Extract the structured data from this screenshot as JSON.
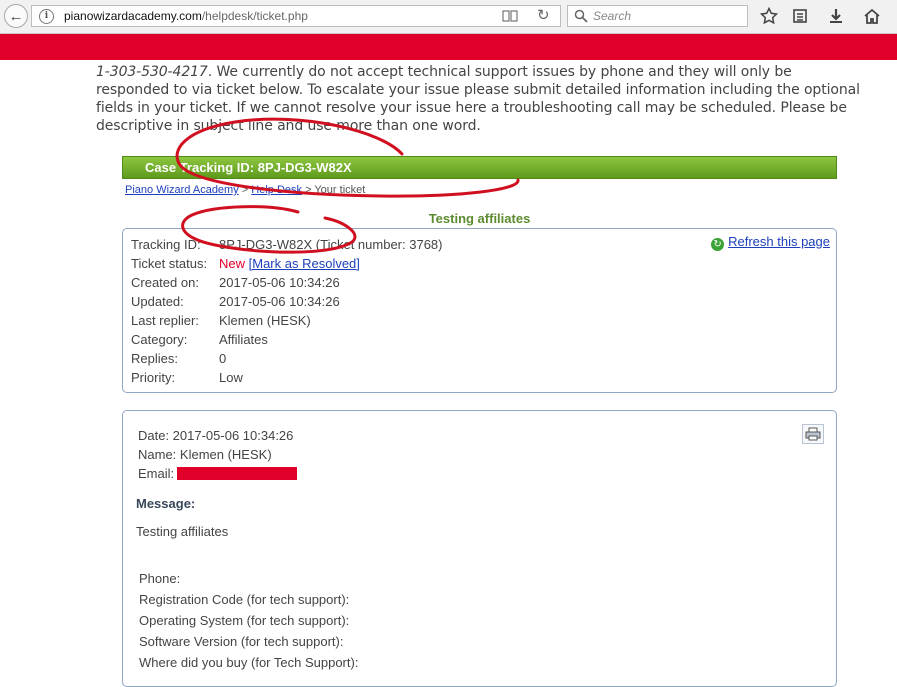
{
  "browser": {
    "url_host": "pianowizardacademy.com",
    "url_path": "/helpdesk/ticket.php",
    "search_placeholder": "Search"
  },
  "intro": {
    "phone": "1-303-530-4217",
    "text": ". We currently do not accept technical support issues by phone and they will only be responded to via ticket below. To escalate your issue please submit detailed information including the optional fields in your ticket. If we cannot resolve your issue here a troubleshooting call may be scheduled. Please be descriptive in subject line and use more than one word."
  },
  "case_bar": "Case Tracking ID: 8PJ-DG3-W82X",
  "breadcrumb": {
    "home": "Piano Wizard Academy",
    "sep1": " > ",
    "help": "Help Desk",
    "sep2": " > ",
    "current": "Your ticket"
  },
  "ticket": {
    "subject": "Testing affiliates",
    "refresh_label": "Refresh this page",
    "fields": {
      "tracking_label": "Tracking ID:",
      "tracking_value": "8PJ-DG3-W82X (Ticket number: 3768)",
      "status_label": "Ticket status:",
      "status_value": "New",
      "resolve_link": "[Mark as Resolved]",
      "created_label": "Created on:",
      "created_value": "2017-05-06 10:34:26",
      "updated_label": "Updated:",
      "updated_value": "2017-05-06 10:34:26",
      "replier_label": "Last replier:",
      "replier_value": "Klemen (HESK)",
      "category_label": "Category:",
      "category_value": "Affiliates",
      "replies_label": "Replies:",
      "replies_value": "0",
      "priority_label": "Priority:",
      "priority_value": "Low"
    }
  },
  "message": {
    "date": "Date:  2017-05-06 10:34:26",
    "name": "Name: Klemen (HESK)",
    "email_label": "Email:",
    "heading": "Message:",
    "body": "Testing affiliates",
    "custom_fields": [
      "Phone:",
      "Registration Code (for tech support):",
      "Operating System (for tech support):",
      "Software Version (for tech support):",
      "Where did you buy (for Tech Support):"
    ]
  }
}
